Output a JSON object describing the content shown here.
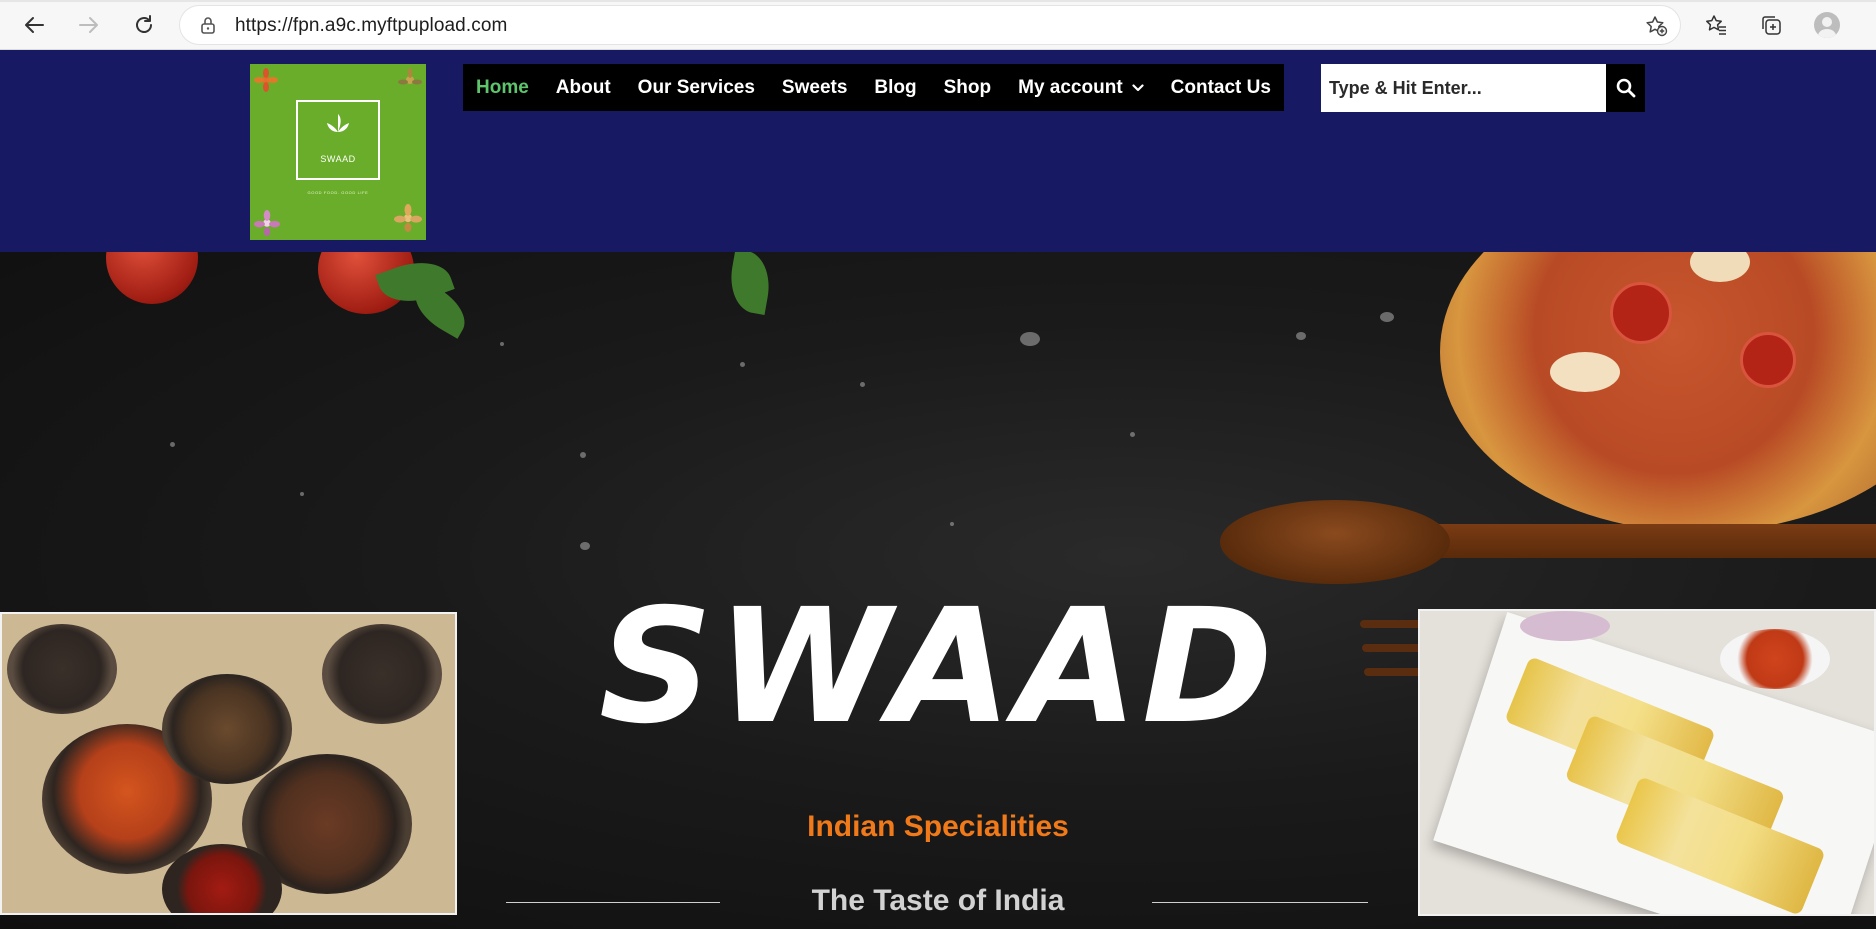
{
  "browser": {
    "url": "https://fpn.a9c.myftpupload.com",
    "icons": [
      "back-arrow-icon",
      "forward-arrow-icon",
      "reload-icon",
      "lock-icon",
      "add-favorite-icon",
      "favorites-icon",
      "collections-icon",
      "profile-avatar-icon"
    ]
  },
  "site": {
    "logo": {
      "word": "SWAAD",
      "tagline": "GOOD FOOD. GOOD LIFE"
    },
    "nav": {
      "items": [
        {
          "label": "Home",
          "active": true
        },
        {
          "label": "About"
        },
        {
          "label": "Our Services"
        },
        {
          "label": "Sweets"
        },
        {
          "label": "Blog"
        },
        {
          "label": "Shop"
        },
        {
          "label": "My account",
          "has_dropdown": true
        },
        {
          "label": "Contact Us"
        }
      ]
    },
    "search": {
      "placeholder": "Type & Hit Enter...",
      "icon": "search-icon"
    }
  },
  "hero": {
    "title": "SWAAD",
    "subtitle": "Indian Specialities",
    "tagline": "The Taste of India"
  },
  "colors": {
    "header_bg": "#181963",
    "nav_bg": "#000000",
    "nav_active": "#5dc56b",
    "logo_bg": "#6aad2a",
    "subtitle": "#f07a1a"
  }
}
